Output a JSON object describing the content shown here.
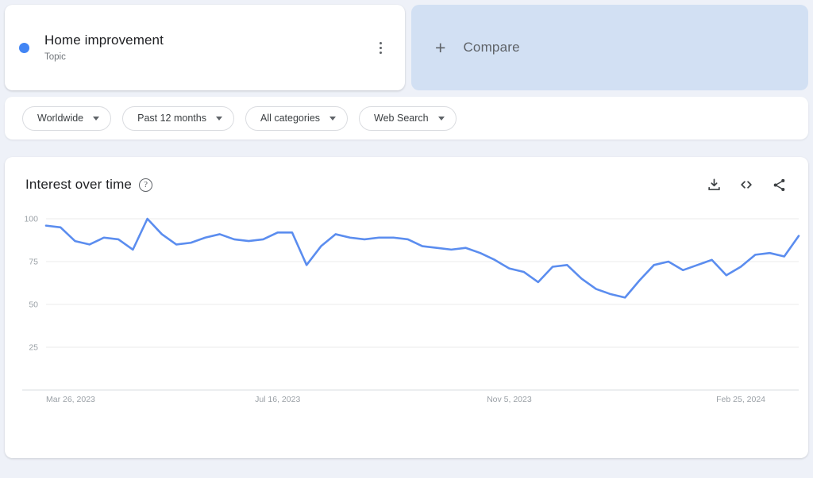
{
  "term_card": {
    "title": "Home improvement",
    "subtype": "Topic",
    "dot_color": "#4285f4",
    "menu_icon": "kebab-menu-icon"
  },
  "compare_card": {
    "label": "Compare",
    "plus_icon": "plus-icon",
    "background": "#d2e0f3"
  },
  "filters": [
    {
      "label": "Worldwide",
      "icon": "chevron-down-icon"
    },
    {
      "label": "Past 12 months",
      "icon": "chevron-down-icon"
    },
    {
      "label": "All categories",
      "icon": "chevron-down-icon"
    },
    {
      "label": "Web Search",
      "icon": "chevron-down-icon"
    }
  ],
  "chart_panel": {
    "title": "Interest over time",
    "help_icon": "help-circle-icon",
    "help_glyph": "?",
    "actions": [
      {
        "name": "download-icon",
        "label": "Download"
      },
      {
        "name": "embed-code-icon",
        "label": "Embed"
      },
      {
        "name": "share-icon",
        "label": "Share"
      }
    ]
  },
  "chart_data": {
    "type": "line",
    "title": "Interest over time",
    "xlabel": "",
    "ylabel": "",
    "ylim": [
      0,
      100
    ],
    "yticks": [
      25,
      50,
      75,
      100
    ],
    "grid": true,
    "legend": false,
    "line_color": "#5b8def",
    "xtick_labels": [
      "Mar 26, 2023",
      "Jul 16, 2023",
      "Nov 5, 2023",
      "Feb 25, 2024"
    ],
    "xtick_positions": [
      0,
      16,
      32,
      48
    ],
    "series": [
      {
        "name": "Home improvement",
        "color": "#5b8def",
        "x": [
          "Mar 26, 2023",
          "Apr 2, 2023",
          "Apr 9, 2023",
          "Apr 16, 2023",
          "Apr 23, 2023",
          "Apr 30, 2023",
          "May 7, 2023",
          "May 14, 2023",
          "May 21, 2023",
          "May 28, 2023",
          "Jun 4, 2023",
          "Jun 11, 2023",
          "Jun 18, 2023",
          "Jun 25, 2023",
          "Jul 2, 2023",
          "Jul 9, 2023",
          "Jul 16, 2023",
          "Jul 23, 2023",
          "Jul 30, 2023",
          "Aug 6, 2023",
          "Aug 13, 2023",
          "Aug 20, 2023",
          "Aug 27, 2023",
          "Sep 3, 2023",
          "Sep 10, 2023",
          "Sep 17, 2023",
          "Sep 24, 2023",
          "Oct 1, 2023",
          "Oct 8, 2023",
          "Oct 15, 2023",
          "Oct 22, 2023",
          "Oct 29, 2023",
          "Nov 5, 2023",
          "Nov 12, 2023",
          "Nov 19, 2023",
          "Nov 26, 2023",
          "Dec 3, 2023",
          "Dec 10, 2023",
          "Dec 17, 2023",
          "Dec 24, 2023",
          "Dec 31, 2023",
          "Jan 7, 2024",
          "Jan 14, 2024",
          "Jan 21, 2024",
          "Jan 28, 2024",
          "Feb 4, 2024",
          "Feb 11, 2024",
          "Feb 18, 2024",
          "Feb 25, 2024",
          "Mar 3, 2024",
          "Mar 10, 2024",
          "Mar 17, 2024"
        ],
        "values": [
          96,
          95,
          87,
          85,
          89,
          88,
          82,
          100,
          91,
          85,
          86,
          89,
          91,
          88,
          87,
          88,
          92,
          92,
          73,
          84,
          91,
          89,
          88,
          89,
          89,
          88,
          84,
          83,
          82,
          83,
          80,
          76,
          71,
          69,
          63,
          72,
          73,
          65,
          59,
          56,
          54,
          64,
          73,
          75,
          70,
          73,
          76,
          67,
          72,
          79,
          80,
          78,
          90
        ]
      }
    ]
  }
}
